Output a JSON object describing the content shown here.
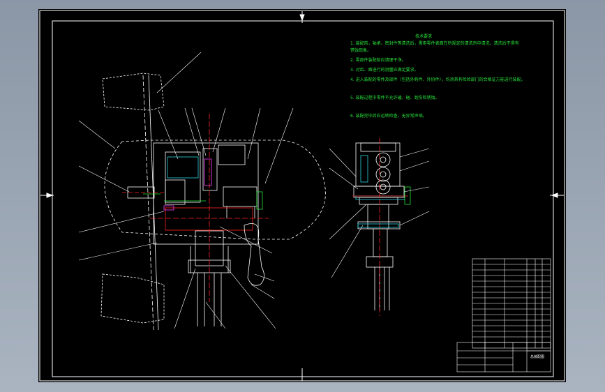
{
  "colors": {
    "background": "#9aa5b3",
    "sheet": "#000000",
    "frame": "#ffffff",
    "notes": "#27e03a",
    "accent_red": "#ff2222",
    "accent_cyan": "#27d3e0",
    "accent_magenta": "#ff40ff"
  },
  "drawing": {
    "main_view": "assembly-front",
    "side_view": "assembly-side",
    "title_block": "parts-list"
  },
  "notes": {
    "title": "技术要求",
    "lines": [
      "1. 装配前，轴承、密封件等清洗后，需用零件表面在所规定的清洗剂中清洗，清洗后不得有",
      "   锈蚀现象。",
      "2. 零部件装配前应清理干净。",
      "3. 对齿、面进行的测量应满足要求。",
      "4. 进入装配的零件及部件（包括外购件、外协件），均须具有检验部门的合格证方能进行装配。",
      "5. 装配过程中零件不允许磕、碰、划伤和锈蚀。",
      "6. 装配完毕后应运转检查，无异常声响。"
    ]
  },
  "title_block": {
    "label": "总装配图"
  }
}
